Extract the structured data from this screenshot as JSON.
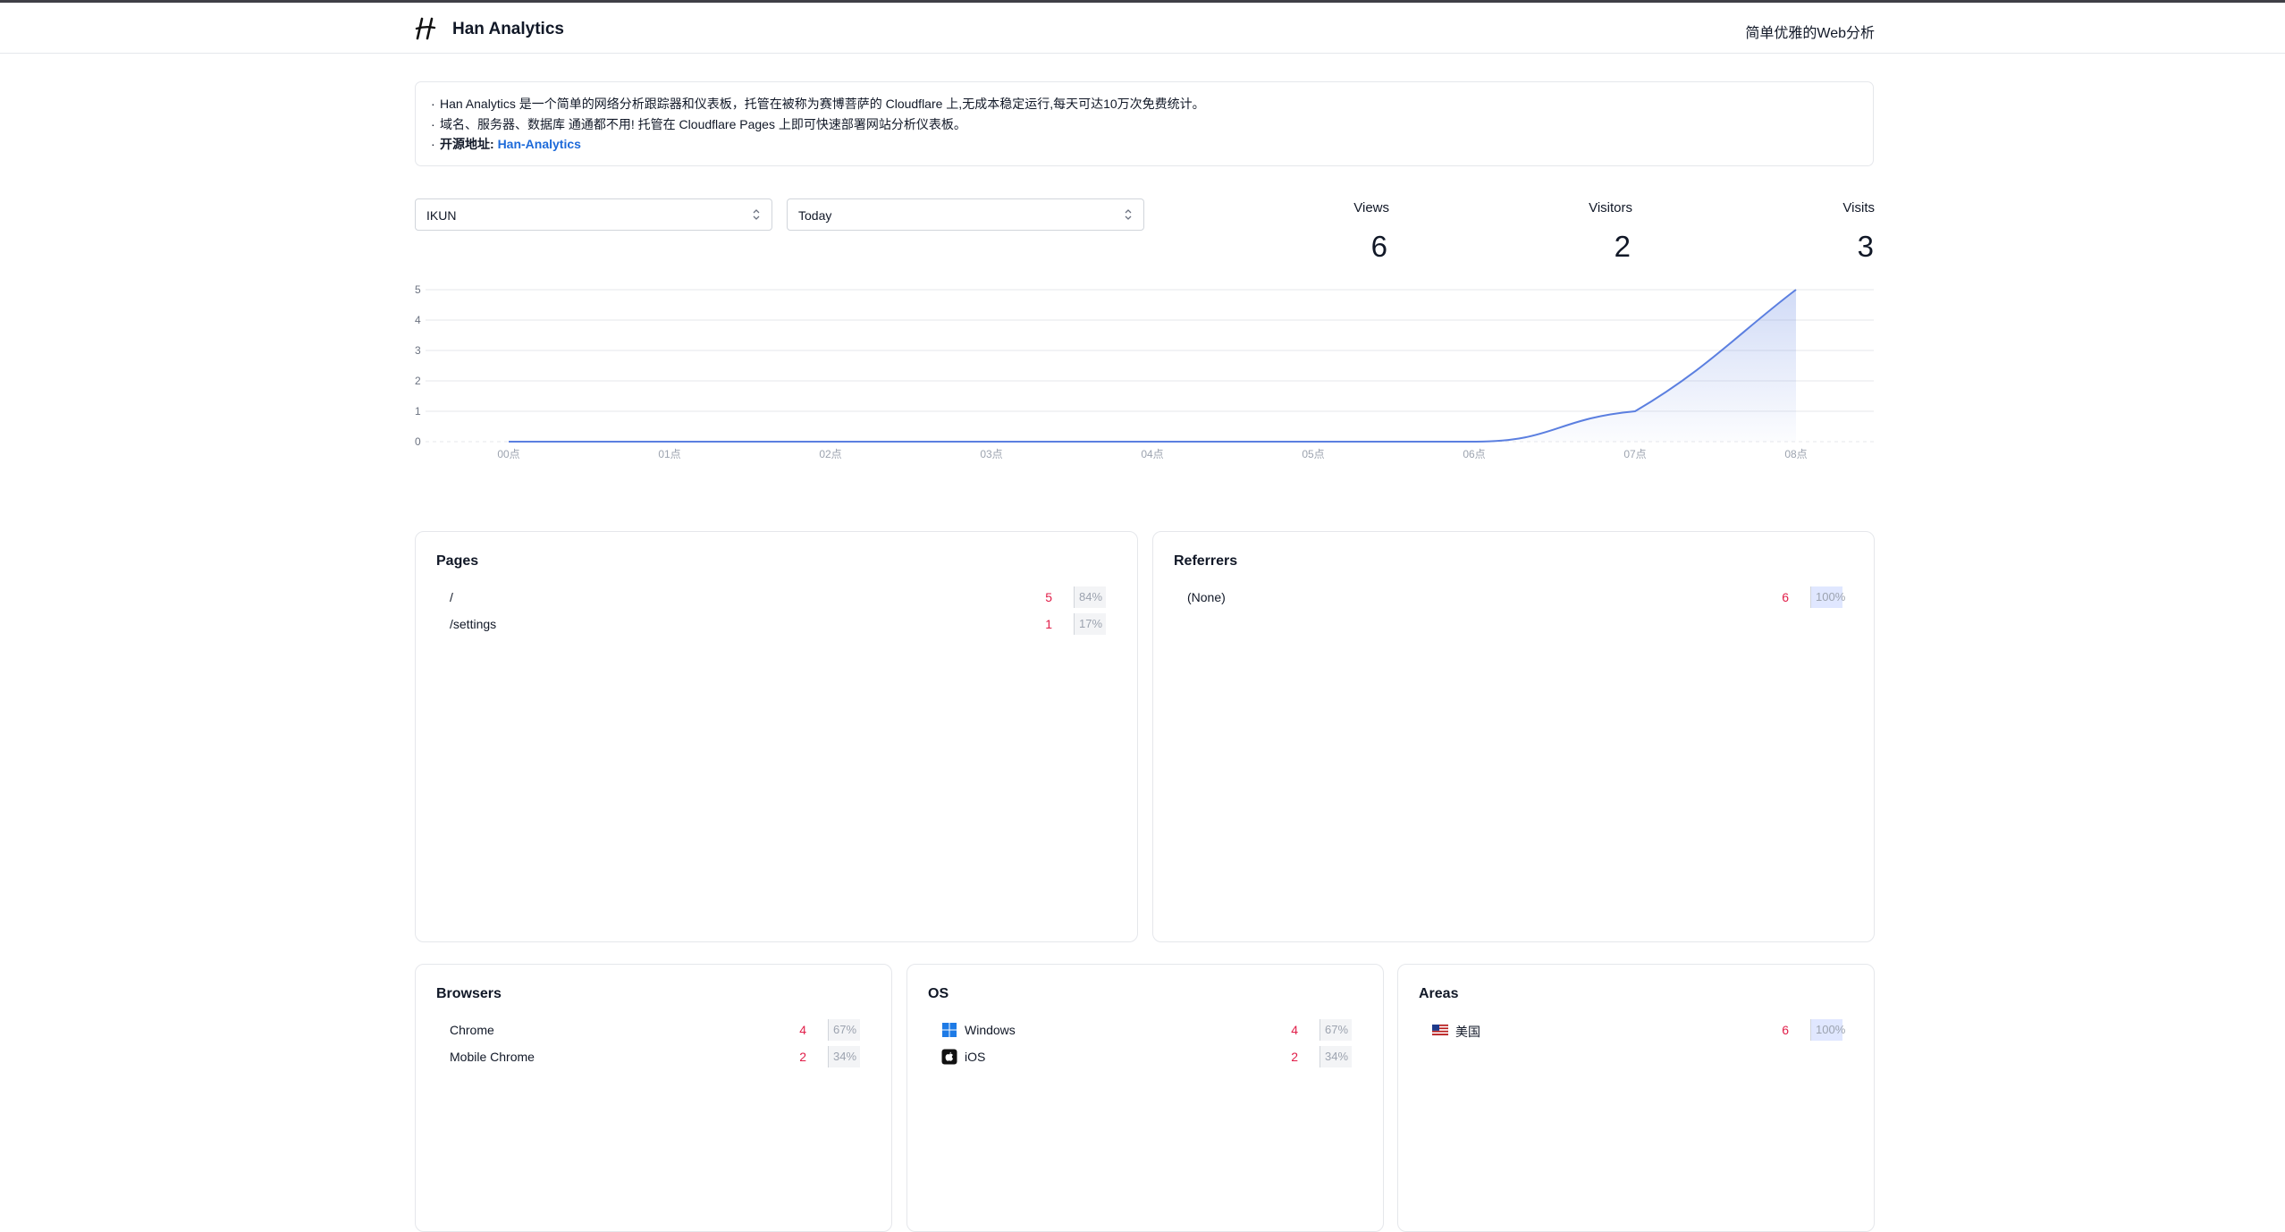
{
  "header": {
    "brand": "Han Analytics",
    "tagline": "简单优雅的Web分析"
  },
  "notice": {
    "lines": [
      "Han Analytics 是一个简单的网络分析跟踪器和仪表板，托管在被称为赛博菩萨的 Cloudflare 上,无成本稳定运行,每天可达10万次免费统计。",
      "域名、服务器、数据库 通通都不用! 托管在 Cloudflare Pages 上即可快速部署网站分析仪表板。"
    ],
    "source_label": "开源地址:",
    "source_link": "Han-Analytics"
  },
  "filters": {
    "site": "IKUN",
    "range": "Today"
  },
  "stats": {
    "views_label": "Views",
    "views_value": "6",
    "visitors_label": "Visitors",
    "visitors_value": "2",
    "visits_label": "Visits",
    "visits_value": "3"
  },
  "chart_data": {
    "type": "area",
    "x": [
      "00点",
      "01点",
      "02点",
      "03点",
      "04点",
      "05点",
      "06点",
      "07点",
      "08点"
    ],
    "series": [
      {
        "values": [
          0,
          0,
          0,
          0,
          0,
          0,
          0,
          1,
          5
        ]
      }
    ],
    "ylim": [
      0,
      5
    ],
    "yticks": [
      "0",
      "1",
      "2",
      "3",
      "4",
      "5"
    ],
    "grid": true,
    "color": "#5b7fe0"
  },
  "pages": {
    "title": "Pages",
    "rows": [
      {
        "name": "/",
        "count": "5",
        "pct": "84%"
      },
      {
        "name": "/settings",
        "count": "1",
        "pct": "17%"
      }
    ]
  },
  "referrers": {
    "title": "Referrers",
    "rows": [
      {
        "name": "(None)",
        "count": "6",
        "pct": "100%"
      }
    ]
  },
  "browsers": {
    "title": "Browsers",
    "rows": [
      {
        "name": "Chrome",
        "count": "4",
        "pct": "67%"
      },
      {
        "name": "Mobile Chrome",
        "count": "2",
        "pct": "34%"
      }
    ]
  },
  "os": {
    "title": "OS",
    "rows": [
      {
        "icon": "windows-icon",
        "name": "Windows",
        "count": "4",
        "pct": "67%"
      },
      {
        "icon": "apple-icon",
        "name": "iOS",
        "count": "2",
        "pct": "34%"
      }
    ]
  },
  "areas": {
    "title": "Areas",
    "rows": [
      {
        "icon": "us-flag-icon",
        "name": "美国",
        "count": "6",
        "pct": "100%"
      }
    ]
  },
  "colors": {
    "accent": "#1d6ad9",
    "count": "#e11d48",
    "line": "#5b7fe0"
  }
}
